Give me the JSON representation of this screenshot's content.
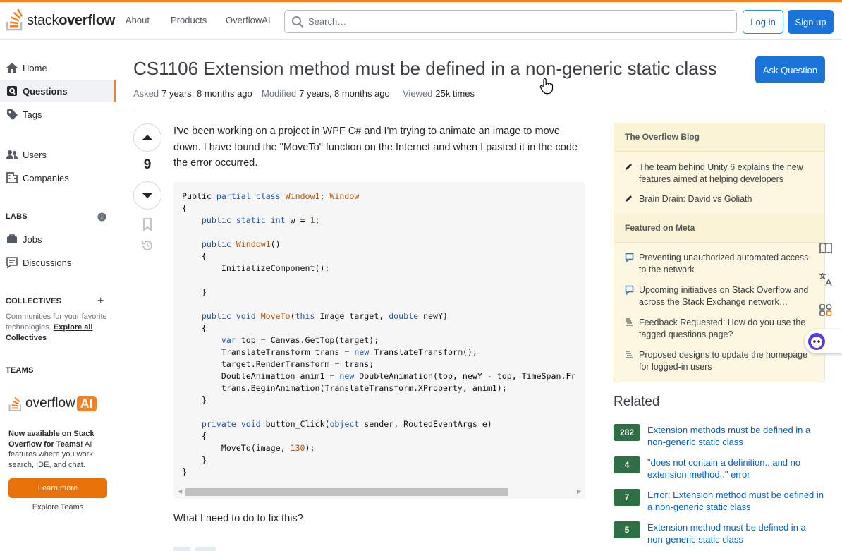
{
  "header": {
    "logo_text_light": "stack",
    "logo_text_bold": "overflow",
    "nav": [
      "About",
      "Products",
      "OverflowAI"
    ],
    "search_placeholder": "Search…",
    "login": "Log in",
    "signup": "Sign up"
  },
  "sidebar": {
    "home": "Home",
    "questions": "Questions",
    "tags": "Tags",
    "users": "Users",
    "companies": "Companies",
    "labs_label": "LABS",
    "jobs": "Jobs",
    "discussions": "Discussions",
    "collectives_label": "COLLECTIVES",
    "collectives_desc": "Communities for your favorite technologies.",
    "collectives_link": "Explore all Collectives",
    "teams_label": "TEAMS",
    "ai_text": "overflow",
    "ai_badge": "AI",
    "ai_desc_bold": "Now available on Stack Overflow for Teams!",
    "ai_desc": "AI features where you work: search, IDE, and chat.",
    "learn_more": "Learn more",
    "explore_teams": "Explore Teams"
  },
  "question": {
    "title": "CS1106 Extension method must be defined in a non-generic static class",
    "ask_button": "Ask Question",
    "asked_label": "Asked",
    "asked_value": "7 years, 8 months ago",
    "modified_label": "Modified",
    "modified_value": "7 years, 8 months ago",
    "viewed_label": "Viewed",
    "viewed_value": "25k times",
    "votes": "9",
    "body": "I've been working on a project in WPF C# and I'm trying to animate an image to move down. I have found the \"MoveTo\" function on the Internet and when I pasted it in the code the error occurred.",
    "footer": "What I need to do to fix this?"
  },
  "blog": {
    "heading": "The Overflow Blog",
    "items": [
      "The team behind Unity 6 explains the new features aimed at helping developers",
      "Brain Drain: David vs Goliath"
    ],
    "meta_heading": "Featured on Meta",
    "meta_items": [
      "Preventing unauthorized automated access to the network",
      "Upcoming initiatives on Stack Overflow and across the Stack Exchange network…",
      "Feedback Requested: How do you use the tagged questions page?",
      "Proposed designs to update the homepage for logged-in users"
    ]
  },
  "related": {
    "heading": "Related",
    "items": [
      {
        "score": "282",
        "title": "Extension methods must be defined in a non-generic static class"
      },
      {
        "score": "4",
        "title": "\"does not contain a definition...and no extension method..\" error"
      },
      {
        "score": "7",
        "title": "Error: Extension method must be defined in a non-generic static class"
      },
      {
        "score": "5",
        "title": "Extension method must be defined in a non-generic static class"
      }
    ]
  },
  "colors": {
    "accent": "#f48225",
    "primary_button": "#1a73d9",
    "score_badge": "#2f6f44",
    "blog_bg": "#fdf7e2"
  }
}
